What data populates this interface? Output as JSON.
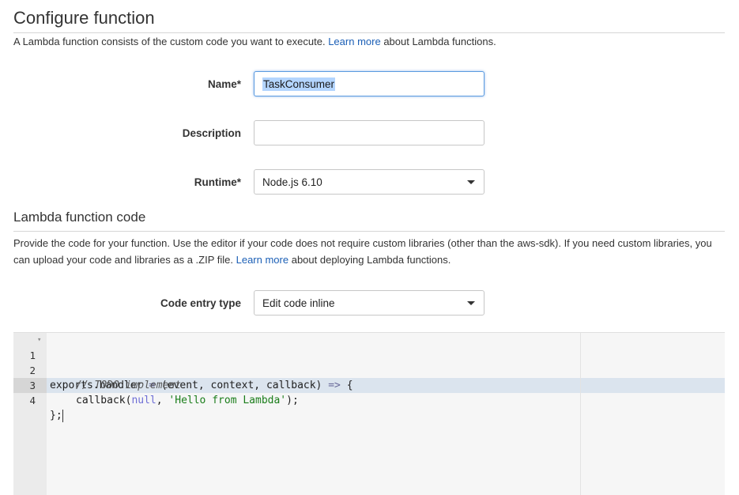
{
  "header": {
    "title": "Configure function",
    "description_pre": "A Lambda function consists of the custom code you want to execute.",
    "learn_more": "Learn more",
    "description_post": "about Lambda functions."
  },
  "form": {
    "name_label": "Name*",
    "name_value": "TaskConsumer",
    "description_label": "Description",
    "description_value": "",
    "runtime_label": "Runtime*",
    "runtime_value": "Node.js 6.10"
  },
  "code_section": {
    "title": "Lambda function code",
    "description_pre": "Provide the code for your function. Use the editor if your code does not require custom libraries (other than the aws-sdk). If you need custom libraries, you can upload your code and libraries as a .ZIP file.",
    "learn_more": "Learn more",
    "description_post": "about deploying Lambda functions.",
    "entry_type_label": "Code entry type",
    "entry_type_value": "Edit code inline"
  },
  "editor": {
    "line_numbers": [
      "1",
      "2",
      "3",
      "4"
    ],
    "lines": {
      "l1_a": "exports.handler ",
      "l1_eq": "=",
      "l1_b": " (event, context, callback) ",
      "l1_arrow": "=>",
      "l1_c": " {",
      "l2": "// TODO implement",
      "l3_a": "callback(",
      "l3_null": "null",
      "l3_b": ", ",
      "l3_str": "'Hello from Lambda'",
      "l3_c": ");",
      "l4": "};"
    }
  }
}
